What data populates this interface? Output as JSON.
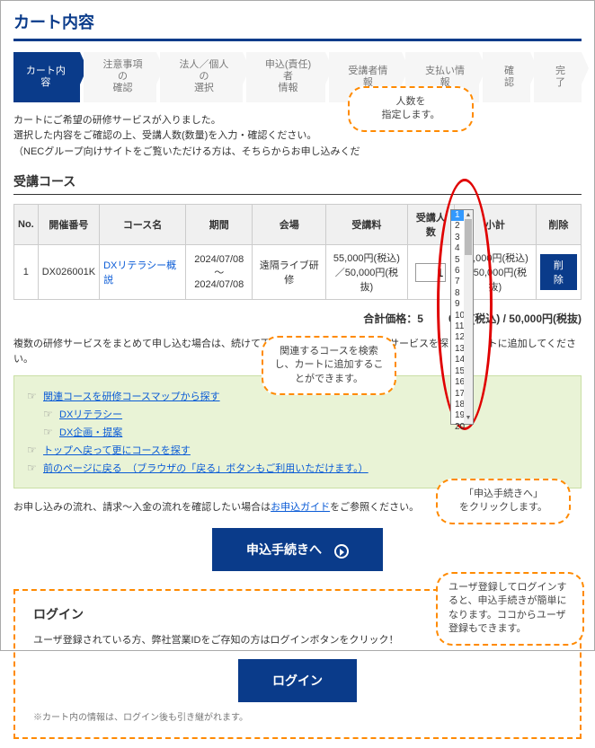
{
  "title": "カート内容",
  "steps": [
    "カート内容",
    "注意事項の\n確認",
    "法人／個人の\n選択",
    "申込(責任)者\n情報",
    "受講者情報",
    "支払い情報",
    "確認",
    "完了"
  ],
  "intro": {
    "l1": "カートにご希望の研修サービスが入りました。",
    "l2": "選択した内容をご確認の上、受講人数(数量)を入力・確認ください。",
    "l3": "（NECグループ向けサイトをご覧いただける方は、そちらからお申し込みくだ"
  },
  "sectionCourses": "受講コース",
  "headers": {
    "no": "No.",
    "code": "開催番号",
    "name": "コース名",
    "period": "期間",
    "venue": "会場",
    "fee": "受講料",
    "qty": "受講人数",
    "subtotal": "小計",
    "del": "削除"
  },
  "row": {
    "no": "1",
    "code": "DX026001K",
    "name": "DXリテラシー概説",
    "period": "2024/07/08～\n2024/07/08",
    "venue": "遠隔ライブ研修",
    "fee": "55,000円(税込)\n／50,000円(税抜)",
    "qty": "1",
    "subtotal": "55,000円(税込)\n／50,000円(税抜)",
    "delBtn": "削除"
  },
  "dropdownOptions": [
    "1",
    "2",
    "3",
    "4",
    "5",
    "6",
    "7",
    "8",
    "9",
    "10",
    "11",
    "12",
    "13",
    "14",
    "15",
    "16",
    "17",
    "18",
    "19",
    "20"
  ],
  "totalLabel": "合計価格：5",
  "totalValue": "00円(税込) / 50,000円(税抜)",
  "moreInfo": "複数の研修サービスをまとめて申し込む場合は、続けて下記のリンク先から別の研修サービスを探して　　トに追加してください。",
  "related": {
    "map": "関連コースを研修コースマップから探す",
    "l1": "DXリテラシー",
    "l2": "DX企画・提案",
    "top": "トップへ戻って更にコースを探す",
    "back": "前のページに戻る　（ブラウザの「戻る」ボタンもご利用いただけます。）"
  },
  "guide": {
    "pre": "お申し込みの流れ、請求～入金の流れを確認したい場合は",
    "link": "お申込ガイド",
    "post": "をご参照ください。"
  },
  "proceedBtn": "申込手続きへ",
  "login": {
    "h": "ログイン",
    "msg": "ユーザ登録されている方、弊社営業IDをご存知の方はログインボタンをクリック！",
    "btn": "ログイン",
    "note": "※カート内の情報は、ログイン後も引き継がれます。"
  },
  "callouts": {
    "c1": "人数を\n指定します。",
    "c2": "関連するコースを検索し、カートに追加することができます。",
    "c3": "「申込手続きへ」\nをクリックします。",
    "c4": "ユーザ登録してログインすると、申込手続きが簡単になります。ココからユーザ登録もできます。"
  }
}
